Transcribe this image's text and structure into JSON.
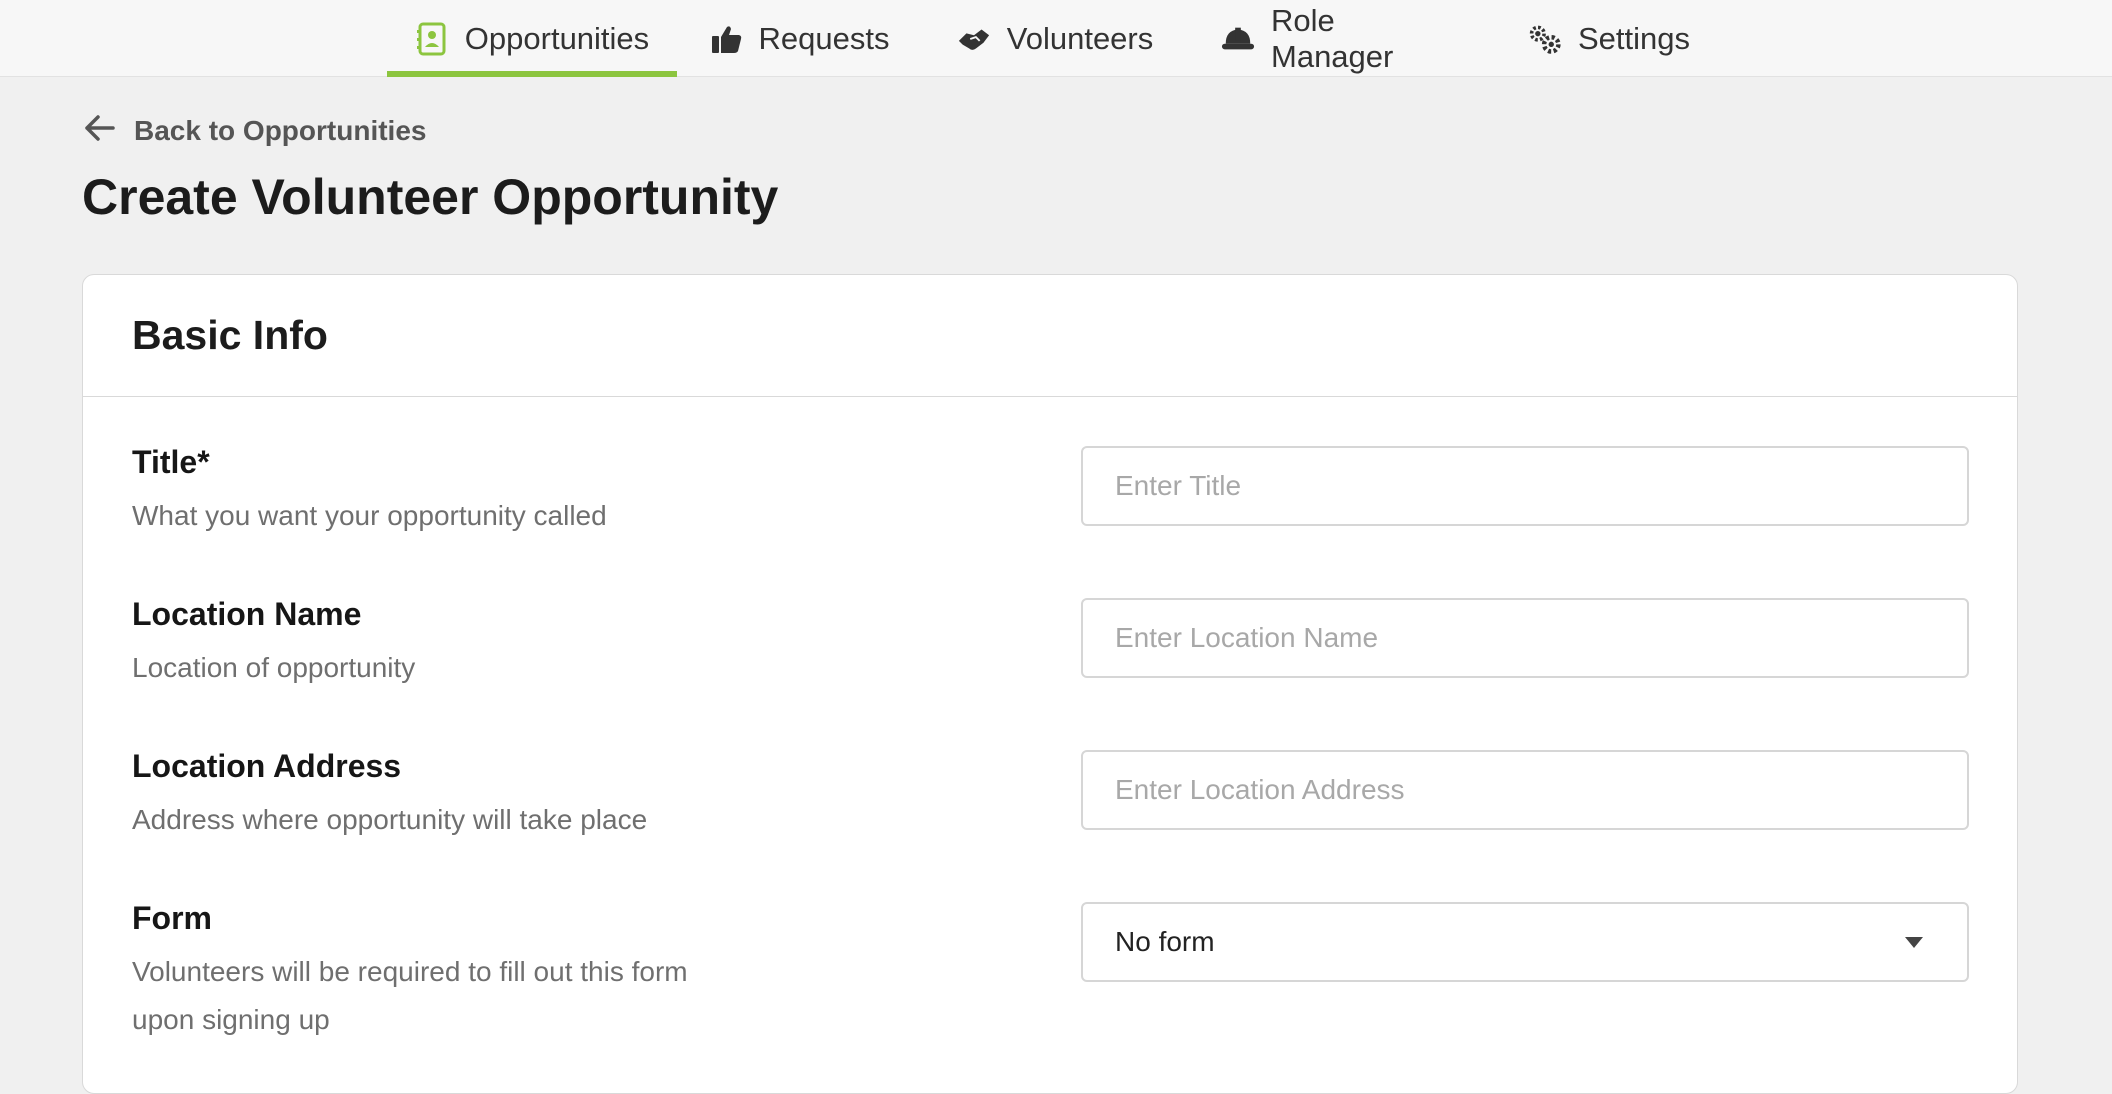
{
  "nav": {
    "tabs": [
      {
        "label": "Opportunities",
        "icon": "contact-card-icon"
      },
      {
        "label": "Requests",
        "icon": "thumbs-up-icon"
      },
      {
        "label": "Volunteers",
        "icon": "handshake-icon"
      },
      {
        "label": "Role Manager",
        "icon": "hard-hat-icon"
      },
      {
        "label": "Settings",
        "icon": "gears-icon"
      }
    ],
    "active_tab": "Opportunities",
    "accent_color": "#8cc53f"
  },
  "back_link": {
    "label": "Back to Opportunities",
    "icon": "arrow-left-icon"
  },
  "page_title": "Create Volunteer Opportunity",
  "card": {
    "title": "Basic Info",
    "fields": [
      {
        "label": "Title*",
        "description": "What you want your opportunity called",
        "placeholder": "Enter Title",
        "value": ""
      },
      {
        "label": "Location Name",
        "description": "Location of opportunity",
        "placeholder": "Enter Location Name",
        "value": ""
      },
      {
        "label": "Location Address",
        "description": "Address where opportunity will take place",
        "placeholder": "Enter Location Address",
        "value": ""
      },
      {
        "label": "Form",
        "description": "Volunteers will be required to fill out this form upon signing up",
        "selected": "No form"
      }
    ]
  }
}
